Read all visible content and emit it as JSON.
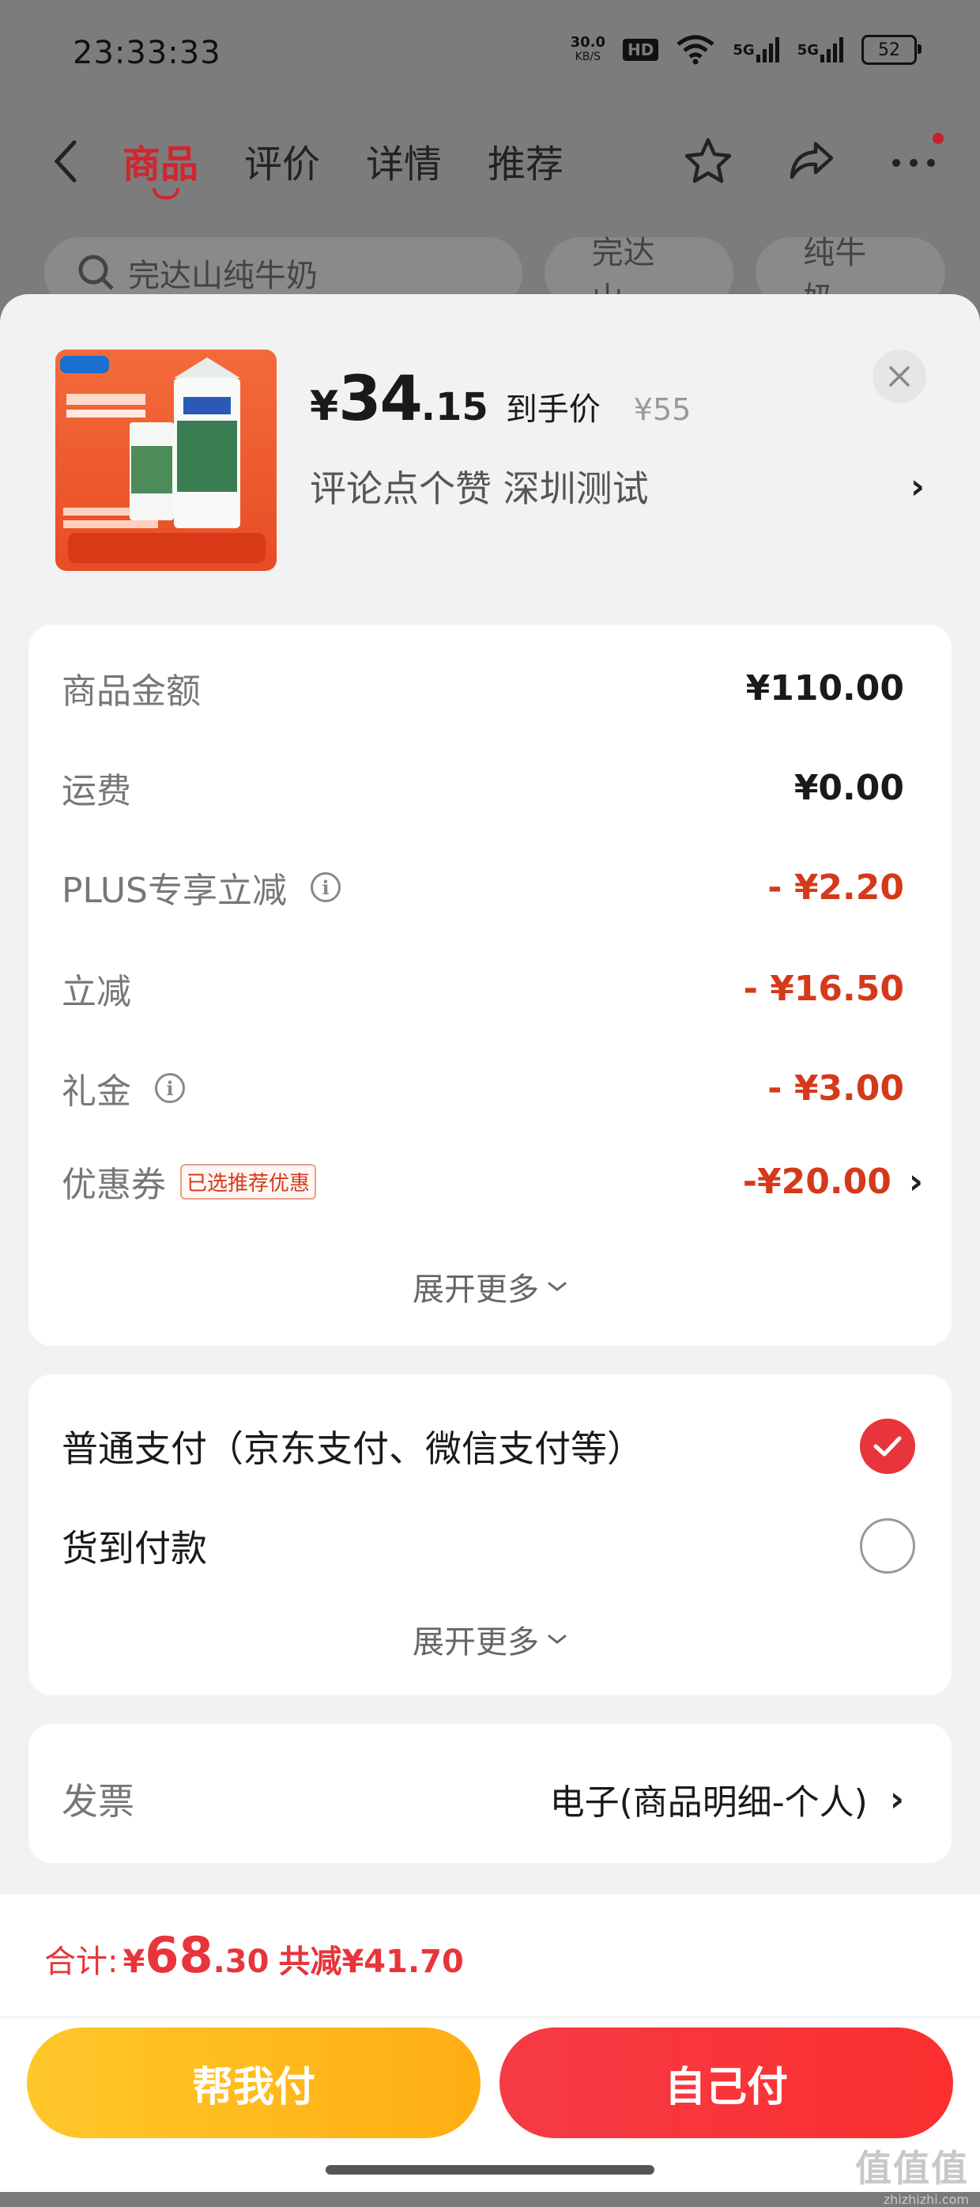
{
  "status_bar": {
    "time": "23:33:33",
    "net_speed": "30.0",
    "net_unit": "KB/S",
    "hd": "HD",
    "sim1": "5G",
    "sim2": "5G",
    "battery": "52"
  },
  "nav": {
    "tabs": [
      {
        "label": "商品",
        "active": true
      },
      {
        "label": "评价",
        "active": false
      },
      {
        "label": "详情",
        "active": false
      },
      {
        "label": "推荐",
        "active": false
      }
    ],
    "icons": [
      "back-icon",
      "star-icon",
      "share-icon",
      "more-icon"
    ]
  },
  "search": {
    "query": "完达山纯牛奶",
    "chips": [
      "完达山",
      "纯牛奶"
    ]
  },
  "sheet": {
    "product": {
      "price_symbol": "¥",
      "price_int": "34",
      "price_dec": ".15",
      "price_tag": "到手价",
      "original_price": "¥55",
      "sku_text": "评论点个赞  深圳测试",
      "thumb_brand": "完达山"
    },
    "amount": {
      "rows": [
        {
          "label": "商品金额",
          "value": "¥110.00",
          "info": false,
          "red": false
        },
        {
          "label": "运费",
          "value": "¥0.00",
          "info": false,
          "red": false
        },
        {
          "label": "PLUS专享立减",
          "value": "- ¥2.20",
          "info": true,
          "red": true
        },
        {
          "label": "立减",
          "value": "- ¥16.50",
          "info": false,
          "red": true
        },
        {
          "label": "礼金",
          "value": "- ¥3.00",
          "info": true,
          "red": true
        }
      ],
      "coupon": {
        "label": "优惠券",
        "badge": "已选推荐优惠",
        "value": "-¥20.00"
      },
      "expand_label": "展开更多"
    },
    "payment": {
      "options": [
        {
          "label": "普通支付（京东支付、微信支付等）",
          "selected": true
        },
        {
          "label": "货到付款",
          "selected": false
        }
      ],
      "expand_label": "展开更多"
    },
    "invoice": {
      "label": "发票",
      "value": "电子(商品明细-个人)"
    }
  },
  "bottom": {
    "total_label": "合计:",
    "total_symbol": "¥",
    "total_int": "68",
    "total_dec": ".30",
    "total_saved": "共减¥41.70",
    "help_pay": "帮我付",
    "self_pay": "自己付"
  },
  "watermark": {
    "text": "值值值",
    "site": "zhizhizhi.com"
  },
  "colors": {
    "accent_red": "#e8343b",
    "discount_red": "#d43a1a",
    "help_yellow": "#ffb81a"
  }
}
